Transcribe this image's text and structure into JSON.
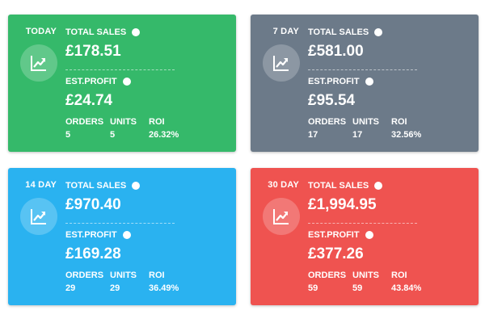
{
  "cards": [
    {
      "period": "TODAY",
      "bg": "#35b96a",
      "total_sales_label": "TOTAL SALES",
      "total_sales": "£178.51",
      "est_profit_label": "EST.PROFIT",
      "est_profit": "£24.74",
      "orders_label": "ORDERS",
      "orders": "5",
      "units_label": "UNITS",
      "units": "5",
      "roi_label": "ROI",
      "roi": "26.32%"
    },
    {
      "period": "7 DAY",
      "bg": "#6c7a89",
      "total_sales_label": "TOTAL SALES",
      "total_sales": "£581.00",
      "est_profit_label": "EST.PROFIT",
      "est_profit": "£95.54",
      "orders_label": "ORDERS",
      "orders": "17",
      "units_label": "UNITS",
      "units": "17",
      "roi_label": "ROI",
      "roi": "32.56%"
    },
    {
      "period": "14 DAY",
      "bg": "#2ab2f0",
      "total_sales_label": "TOTAL SALES",
      "total_sales": "£970.40",
      "est_profit_label": "EST.PROFIT",
      "est_profit": "£169.28",
      "orders_label": "ORDERS",
      "orders": "29",
      "units_label": "UNITS",
      "units": "29",
      "roi_label": "ROI",
      "roi": "36.49%"
    },
    {
      "period": "30 DAY",
      "bg": "#ef5350",
      "total_sales_label": "TOTAL SALES",
      "total_sales": "£1,994.95",
      "est_profit_label": "EST.PROFIT",
      "est_profit": "£377.26",
      "orders_label": "ORDERS",
      "orders": "59",
      "units_label": "UNITS",
      "units": "59",
      "roi_label": "ROI",
      "roi": "43.84%"
    }
  ],
  "icons": {
    "card_icon": "trending-chart-icon",
    "info_icon": "info-icon"
  }
}
